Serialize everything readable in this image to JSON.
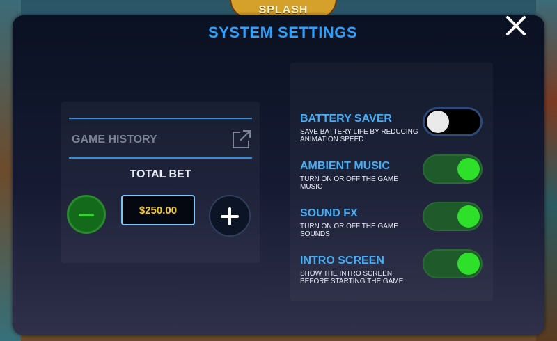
{
  "game": {
    "logo_text": "SPLASH"
  },
  "dialog": {
    "title": "SYSTEM SETTINGS"
  },
  "history": {
    "label": "GAME HISTORY"
  },
  "bet": {
    "label": "TOTAL BET",
    "value": "$250.00"
  },
  "settings": [
    {
      "title": "BATTERY SAVER",
      "description": "SAVE BATTERY LIFE BY REDUCING ANIMATION SPEED",
      "enabled": false
    },
    {
      "title": "AMBIENT MUSIC",
      "description": "TURN ON OR OFF THE GAME MUSIC",
      "enabled": true
    },
    {
      "title": "SOUND FX",
      "description": "TURN ON OR OFF THE GAME SOUNDS",
      "enabled": true
    },
    {
      "title": "INTRO SCREEN",
      "description": "SHOW THE INTRO SCREEN BEFORE STARTING THE GAME",
      "enabled": true
    }
  ],
  "colors": {
    "accent_blue": "#2aa0ff",
    "toggle_on": "#2fe02a",
    "bet_value": "#f2c82a",
    "minus_button": "#136a1a"
  },
  "icons": {
    "close": "close-icon",
    "external_link": "external-link-icon",
    "minus": "minus-icon",
    "plus": "plus-icon"
  }
}
